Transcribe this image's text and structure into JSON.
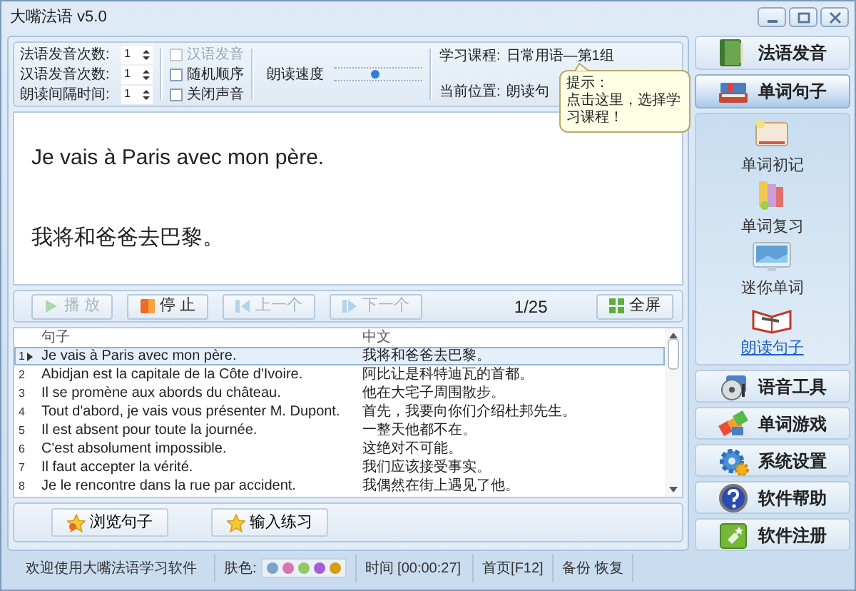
{
  "window": {
    "title": "大嘴法语 v5.0"
  },
  "settings": {
    "spinners": [
      {
        "label": "法语发音次数:",
        "value": "1"
      },
      {
        "label": "汉语发音次数:",
        "value": "1"
      },
      {
        "label": "朗读间隔时间:",
        "value": "1"
      }
    ],
    "checkboxes": [
      {
        "label": "汉语发音",
        "checked": false,
        "disabled": true
      },
      {
        "label": "随机顺序",
        "checked": false,
        "disabled": false
      },
      {
        "label": "关闭声音",
        "checked": false,
        "disabled": false
      }
    ],
    "speed": {
      "label": "朗读速度",
      "level": 0.47
    },
    "course": {
      "label": "学习课程:",
      "value": "日常用语—第1组"
    },
    "position": {
      "label": "当前位置:",
      "value": "朗读句"
    }
  },
  "tooltip": {
    "title": "提示：",
    "text": "点击这里，选择学习课程！"
  },
  "display": {
    "french": "Je vais à Paris avec mon père.",
    "chinese": "我将和爸爸去巴黎。"
  },
  "player": {
    "buttons": [
      {
        "label": "播 放",
        "kind": "play",
        "disabled": true
      },
      {
        "label": "停 止",
        "kind": "stop",
        "disabled": false
      },
      {
        "label": "上一个",
        "kind": "prev",
        "disabled": true
      },
      {
        "label": "下一个",
        "kind": "next",
        "disabled": true
      }
    ],
    "counter": "1/25",
    "fullscreen": "全屏"
  },
  "table": {
    "columns": [
      "句子",
      "中文"
    ],
    "rows": [
      {
        "number": "1",
        "french": "Je vais à Paris avec mon père.",
        "chinese": "我将和爸爸去巴黎。",
        "selected": true
      },
      {
        "number": "2",
        "french": "Abidjan est la capitale de la Côte d'Ivoire.",
        "chinese": "阿比让是科特迪瓦的首都。",
        "selected": false
      },
      {
        "number": "3",
        "french": "Il se promène aux abords du château.",
        "chinese": "他在大宅子周围散步。",
        "selected": false
      },
      {
        "number": "4",
        "french": "Tout d'abord, je vais vous présenter M. Dupont.",
        "chinese": "首先，我要向你们介绍杜邦先生。",
        "selected": false
      },
      {
        "number": "5",
        "french": "Il est absent pour toute la journée.",
        "chinese": "一整天他都不在。",
        "selected": false
      },
      {
        "number": "6",
        "french": "C'est absolument impossible.",
        "chinese": "这绝对不可能。",
        "selected": false
      },
      {
        "number": "7",
        "french": "Il faut accepter la vérité.",
        "chinese": "我们应该接受事实。",
        "selected": false
      },
      {
        "number": "8",
        "french": "Je le rencontre dans la rue par accident.",
        "chinese": "我偶然在街上遇见了他。",
        "selected": false
      }
    ]
  },
  "actions": [
    "浏览句子",
    "输入练习"
  ],
  "status_bar": {
    "welcome": "欢迎使用大嘴法语学习软件",
    "skin_label": "肤色:",
    "skins": [
      {
        "color": "#7aa4cc"
      },
      {
        "color": "#d874b0"
      },
      {
        "color": "#94c864"
      },
      {
        "color": "#a45ed8"
      },
      {
        "color": "#d89c10"
      }
    ],
    "time": "时间 [00:00:27]",
    "home": "首页[F12]",
    "backup": "备份",
    "restore": "恢复"
  },
  "sidebar": {
    "modules": [
      {
        "label": "法语发音",
        "selected": false
      },
      {
        "label": "单词句子",
        "selected": true
      }
    ],
    "items": [
      {
        "label": "单词初记",
        "selected": false
      },
      {
        "label": "单词复习",
        "selected": false
      },
      {
        "label": "迷你单词",
        "selected": false
      },
      {
        "label": "朗读句子",
        "selected": true
      }
    ],
    "tools": [
      {
        "label": "语音工具"
      },
      {
        "label": "单词游戏"
      },
      {
        "label": "系统设置"
      },
      {
        "label": "软件帮助"
      },
      {
        "label": "软件注册"
      }
    ]
  }
}
